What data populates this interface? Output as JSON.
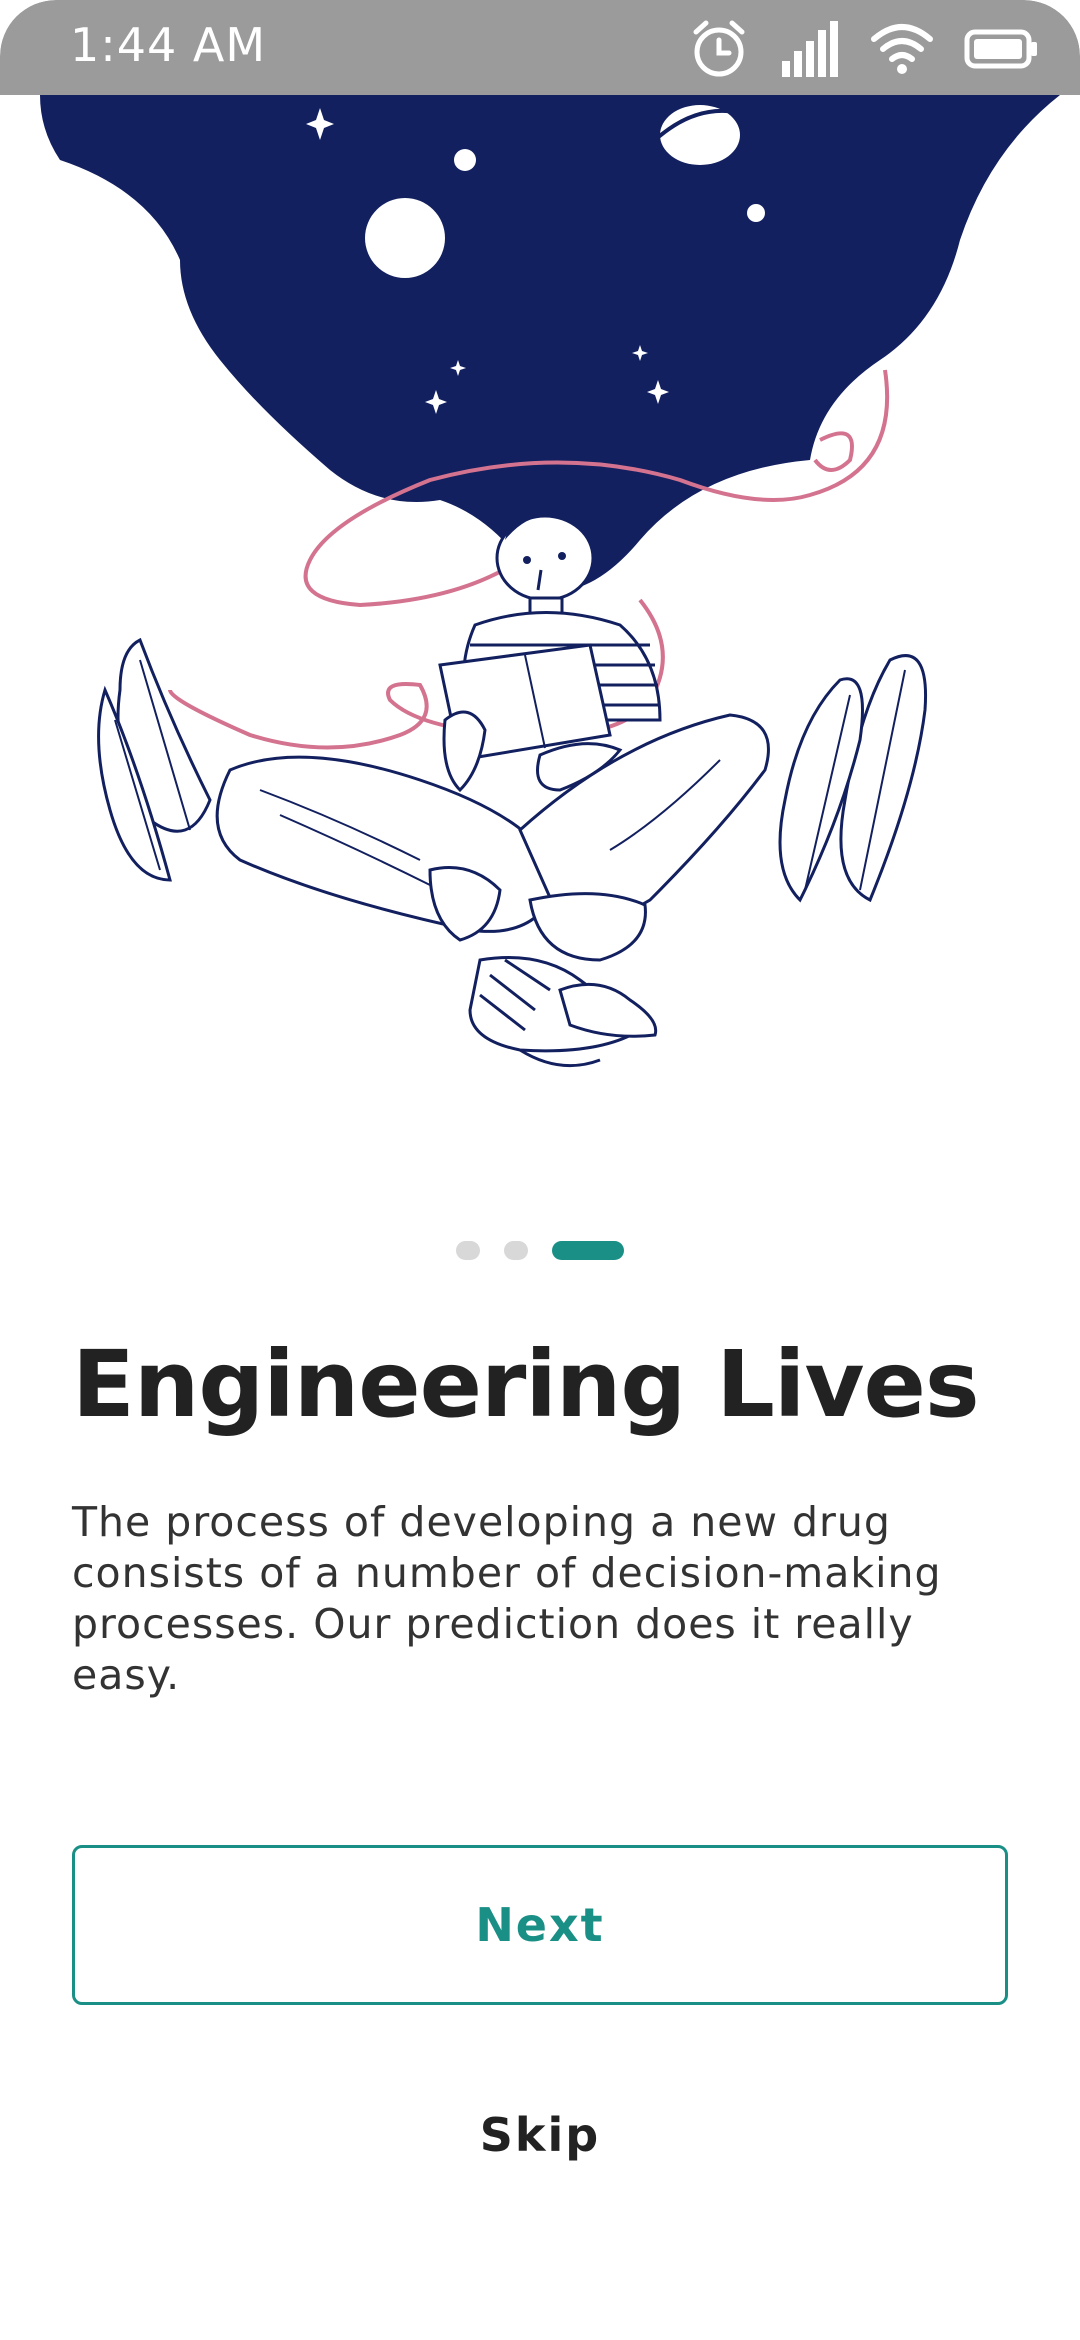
{
  "status_bar": {
    "time": "1:44 AM",
    "icons": [
      "alarm-icon",
      "signal-icon",
      "wifi-icon",
      "battery-icon"
    ]
  },
  "onboarding": {
    "page_indicator": {
      "total": 3,
      "active_index": 2
    },
    "title": "Engineering Lives",
    "description": "The process of  developing a new drug consists of a number of decision-making processes. Our prediction does it really easy.",
    "next_label": "Next",
    "skip_label": "Skip"
  },
  "colors": {
    "accent": "#1a8f86",
    "night_sky": "#13205f",
    "hair_ribbon": "#d4738f",
    "status_bar": "#9b9b9b",
    "title_text": "#222222"
  }
}
